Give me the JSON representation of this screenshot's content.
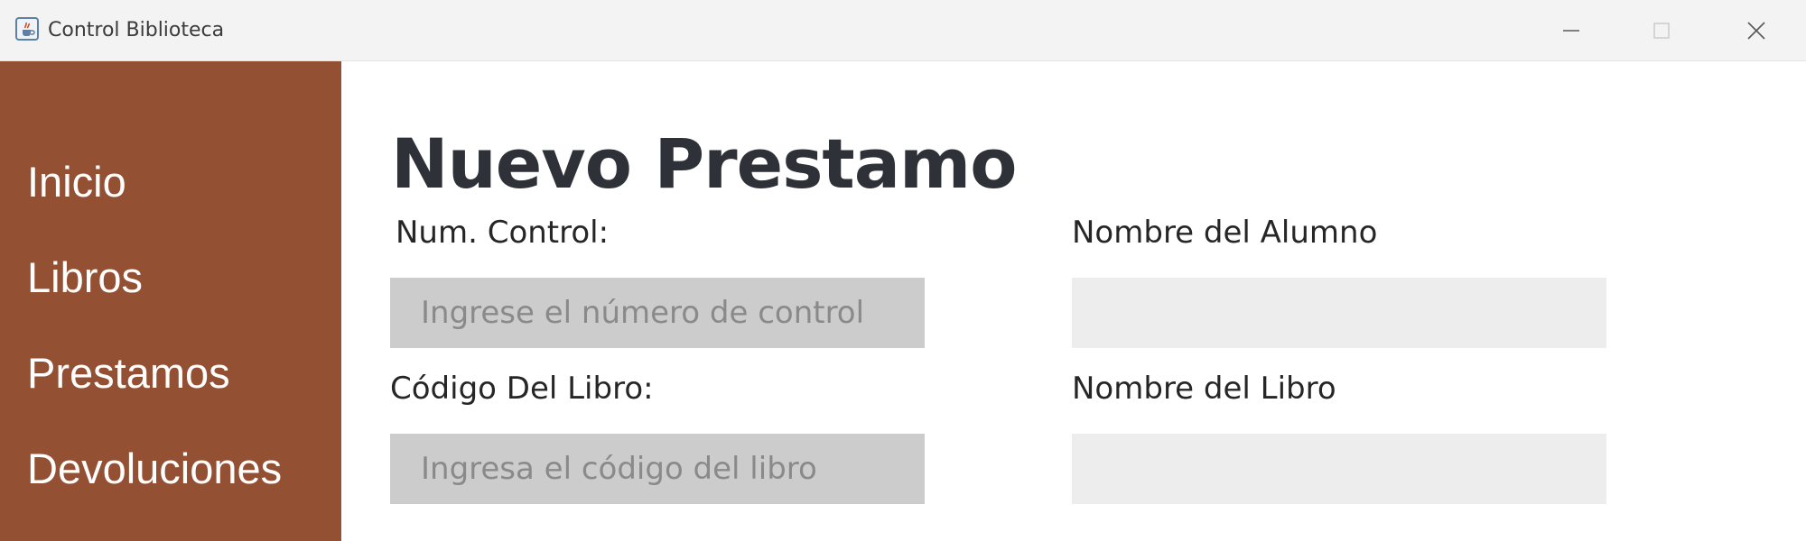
{
  "window": {
    "title": "Control Biblioteca",
    "icon": "java-cup-icon",
    "controls": [
      "minimize-icon",
      "maximize-icon",
      "close-icon"
    ]
  },
  "sidebar": {
    "background": "#935033",
    "items": [
      {
        "label": "Inicio"
      },
      {
        "label": "Libros"
      },
      {
        "label": "Prestamos"
      },
      {
        "label": "Devoluciones"
      }
    ]
  },
  "form": {
    "title": "Nuevo Prestamo",
    "num_control": {
      "label": "Num. Control:",
      "value": "",
      "placeholder": "Ingrese el número de control"
    },
    "nombre_alumno": {
      "label": "Nombre del Alumno",
      "value": "",
      "placeholder": ""
    },
    "codigo_libro": {
      "label": "Código Del Libro:",
      "value": "",
      "placeholder": "Ingresa el código del libro"
    },
    "nombre_libro": {
      "label": "Nombre del Libro",
      "value": "",
      "placeholder": ""
    }
  }
}
